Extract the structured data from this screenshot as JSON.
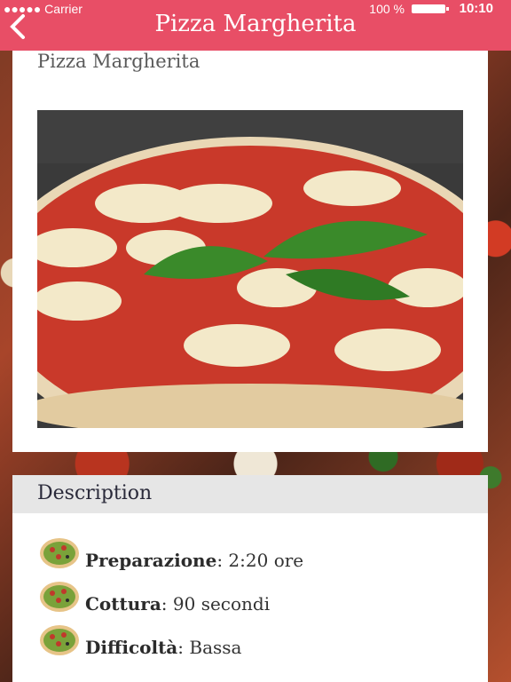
{
  "status_bar": {
    "carrier": "●●●●● Carrier",
    "battery": "100 %",
    "time": "10:10"
  },
  "nav": {
    "title": "Pizza Margherita",
    "back_icon": "chevron-left-icon",
    "color": "#e84e66"
  },
  "recipe": {
    "title": "Pizza Margherita",
    "image_alt": "pizza photo"
  },
  "description": {
    "heading": "Description",
    "rows": [
      {
        "label": "Preparazione",
        "sep": ": ",
        "value": "2:20 ore"
      },
      {
        "label": "Cottura",
        "sep": ": ",
        "value": "90 secondi"
      },
      {
        "label": "Difficoltà",
        "sep": ": ",
        "value": "Bassa"
      }
    ]
  }
}
